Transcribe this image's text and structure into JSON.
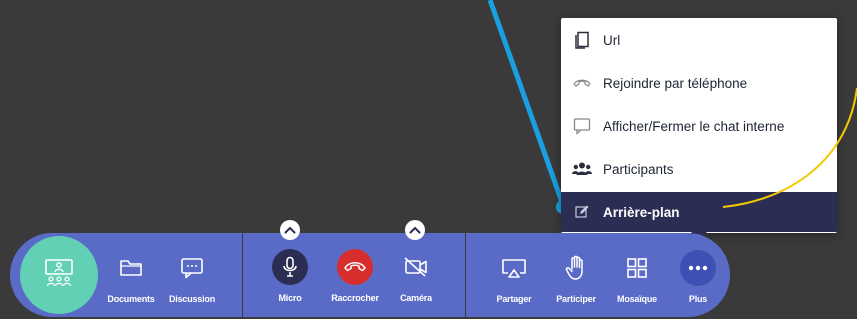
{
  "menu": {
    "items": [
      {
        "label": "Url",
        "icon": "copy-icon"
      },
      {
        "label": "Rejoindre par téléphone",
        "icon": "phone-icon"
      },
      {
        "label": "Afficher/Fermer le chat interne",
        "icon": "chat-icon"
      },
      {
        "label": "Participants",
        "icon": "users-icon"
      },
      {
        "label": "Arrière-plan",
        "icon": "edit-icon",
        "active": true
      }
    ]
  },
  "toolbar": {
    "documents_label": "Documents",
    "discussion_label": "Discussion",
    "micro_label": "Micro",
    "raccrocher_label": "Raccrocher",
    "camera_label": "Caméra",
    "partager_label": "Partager",
    "participer_label": "Participer",
    "mosaique_label": "Mosaïque",
    "plus_label": "Plus"
  },
  "colors": {
    "background": "#3a3a3a",
    "toolbar": "#5a6bc7",
    "rooms_button": "#62d0b4",
    "micro_button": "#2b2e52",
    "hangup_button": "#d82d2d",
    "plus_button": "#3f4fb3",
    "menu_active": "#2b2e52",
    "arrow_annotation": "#1a9fe0",
    "curve_annotation": "#f2c900"
  }
}
